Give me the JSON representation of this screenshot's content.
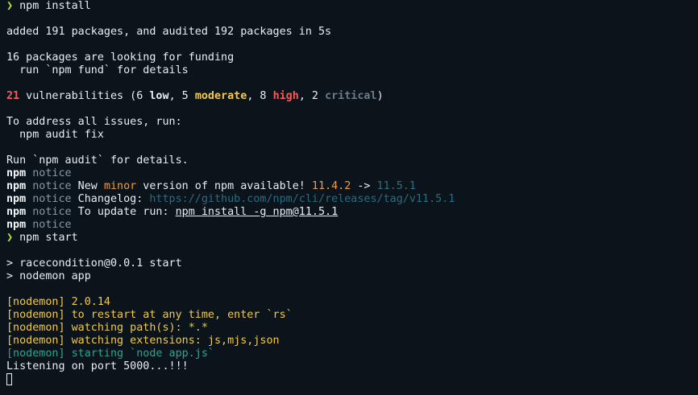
{
  "terminal": {
    "prompt_glyph": "❯",
    "lines": {
      "cmd_install": "npm install",
      "added": "added 191 packages, and audited 192 packages in 5s",
      "funding_1": "16 packages are looking for funding",
      "funding_2": "  run `npm fund` for details",
      "vuln_count": "21",
      "vuln_text": " vulnerabilities (6 ",
      "vuln_low": "low",
      "vuln_sep1": ", 5 ",
      "vuln_moderate": "moderate",
      "vuln_sep2": ", 8 ",
      "vuln_high": "high",
      "vuln_sep3": ", 2 ",
      "vuln_critical": "critical",
      "vuln_close": ")",
      "address_1": "To address all issues, run:",
      "address_2": "  npm audit fix",
      "audit_details": "Run `npm audit` for details.",
      "npm_label": "npm",
      "notice_label": "notice",
      "notice_new_1": " New ",
      "notice_minor": "minor",
      "notice_new_2": " version of npm available! ",
      "notice_from_version": "11.4.2",
      "notice_arrow": " -> ",
      "notice_to_version": "11.5.1",
      "notice_changelog": " Changelog: ",
      "changelog_url": "https://github.com/npm/cli/releases/tag/v11.5.1",
      "notice_update": " To update run: ",
      "update_cmd": "npm install -g npm@11.5.1",
      "cmd_start": "npm start",
      "start_1": "> racecondition@0.0.1 start",
      "start_2": "> nodemon app",
      "nodemon_1": "[nodemon] 2.0.14",
      "nodemon_2": "[nodemon] to restart at any time, enter `rs`",
      "nodemon_3": "[nodemon] watching path(s): *.*",
      "nodemon_4": "[nodemon] watching extensions: js,mjs,json",
      "nodemon_5": "[nodemon] starting `node app.js`",
      "listening": "Listening on port 5000...!!!"
    }
  }
}
